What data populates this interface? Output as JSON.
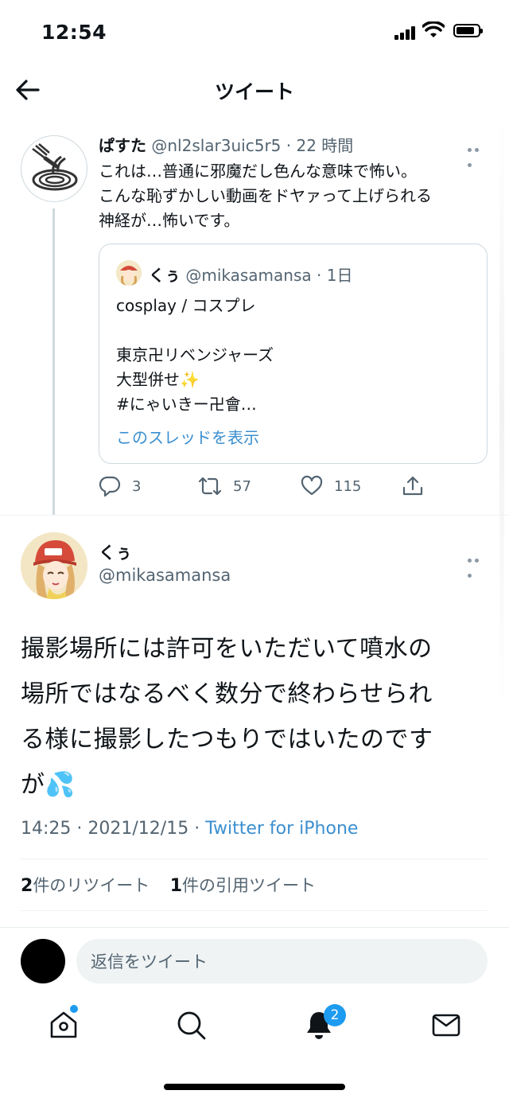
{
  "status_bar": {
    "time": "12:54"
  },
  "header": {
    "title": "ツイート"
  },
  "reply_tweet": {
    "name": "ぱすた",
    "handle": "@nl2slar3uic5r5",
    "sep": " · ",
    "age": "22 時間",
    "text": "これは…普通に邪魔だし色んな意味で怖い。\nこんな恥ずかしい動画をドヤァって上げられる\n神経が…怖いです。",
    "quote": {
      "name": "くぅ",
      "handle": "@mikasamansa",
      "age": "1日",
      "text": "cosplay / コスプレ\n\n東京卍リベンジャーズ\n大型併せ✨\n #にゃいきー卍會…",
      "link": "このスレッドを表示"
    },
    "actions": {
      "replies": "3",
      "retweets": "57",
      "likes": "115"
    }
  },
  "main_tweet": {
    "name": "くぅ",
    "handle": "@mikasamansa",
    "text": "撮影場所には許可をいただいて噴水の\n場所ではなるべく数分で終わらせられ\nる様に撮影したつもりではいたのです\nが💦",
    "time": "14:25",
    "date": "2021/12/15",
    "source": "Twitter for iPhone",
    "retweet_count": "2",
    "retweet_label": "件のリツイート",
    "quote_count": "1",
    "quote_label": "件の引用ツイート"
  },
  "reply_bar": {
    "placeholder": "返信をツイート"
  },
  "bottom_nav": {
    "items": [
      "home-icon",
      "search-icon",
      "notifications-icon",
      "messages-icon"
    ],
    "notification_badge": "2"
  },
  "colors": {
    "accent": "#1d9bf0",
    "text": "#0f1419",
    "secondary": "#536471"
  }
}
